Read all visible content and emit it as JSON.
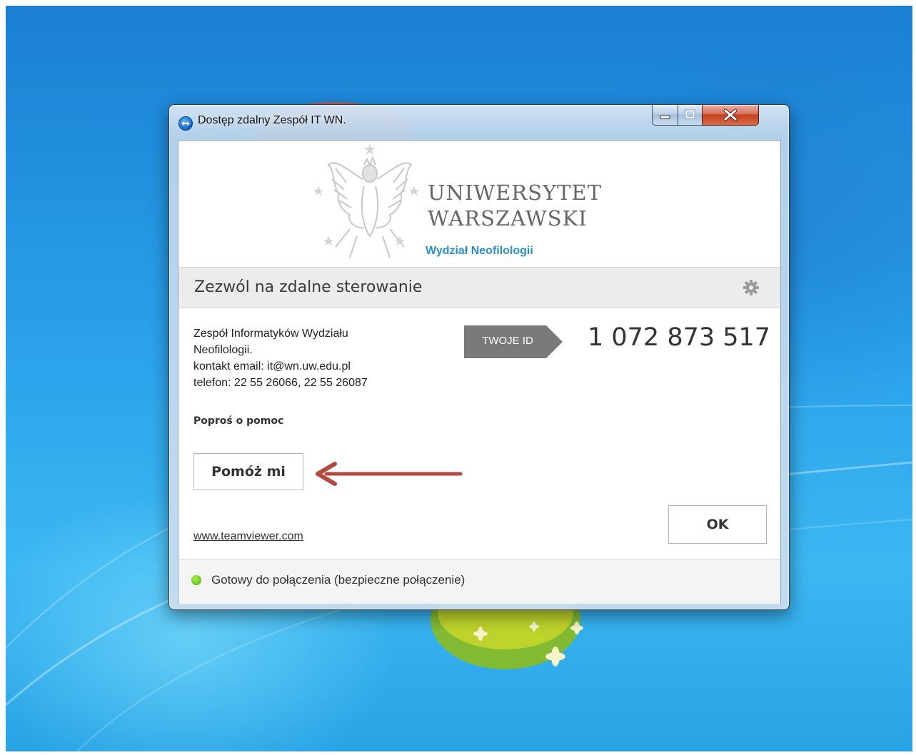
{
  "window": {
    "title": "Dostęp zdalny Zespół IT WN.",
    "app_icon": "teamviewer-icon",
    "controls": [
      "minimize-icon",
      "maximize-icon",
      "close-icon"
    ]
  },
  "logo": {
    "line1": "UNIWERSYTET",
    "line2": "WARSZAWSKI",
    "faculty": "Wydział Neofilologii",
    "emblem": "eagle-emblem"
  },
  "section": {
    "title": "Zezwól na zdalne sterowanie",
    "settings_icon": "gear-icon"
  },
  "info": {
    "line1": "Zespół Informatyków Wydziału",
    "line2": "Neofilologii.",
    "line3": "kontakt email: it@wn.uw.edu.pl",
    "line4": "telefon: 22 55 26066, 22 55 26087"
  },
  "help": {
    "heading": "Poproś o pomoc",
    "button_label": "Pomóż mi"
  },
  "id": {
    "tag_label": "TWOJE ID",
    "value": "1 072 873 517"
  },
  "actions": {
    "ok_label": "OK",
    "link_text": "www.teamviewer.com"
  },
  "status": {
    "text": "Gotowy do połączenia (bezpieczne połączenie)",
    "indicator_color": "#6cc91c"
  },
  "colors": {
    "faculty_accent": "#2a8fd6",
    "arrow": "#b5483f",
    "id_tag": "#7a7a7a"
  }
}
